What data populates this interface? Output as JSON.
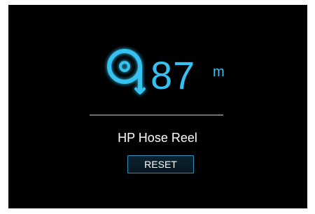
{
  "reel": {
    "length_value": "87",
    "length_unit": "m",
    "name": "HP Hose Reel",
    "icon": "hose-reel-icon",
    "reset_label": "RESET"
  },
  "colors": {
    "accent": "#35c2f0",
    "background": "#000000",
    "text": "#ffffff",
    "button_border": "#2b8fb8"
  }
}
